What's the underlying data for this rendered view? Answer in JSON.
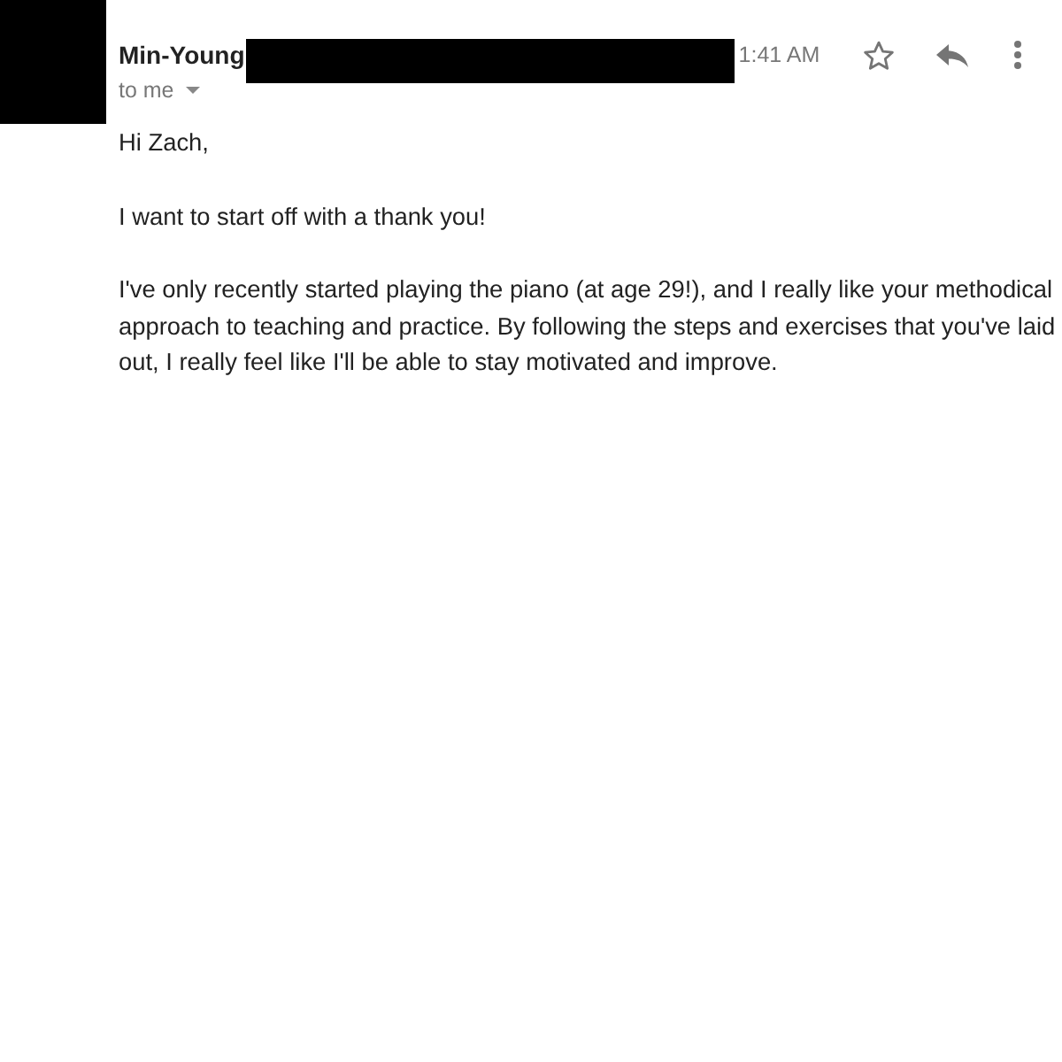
{
  "message": {
    "sender": "Min-Young",
    "recipient": "to me",
    "time": "1:41 AM",
    "starred": false
  },
  "body": [
    "Hi Zach,",
    "I want to start off with a thank you!",
    "I've only recently started playing the piano (at age 29!), and I really like your methodical approach to teaching and practice. By following the steps and exercises that you've laid out, I really feel like I'll be able to stay motivated and improve."
  ]
}
